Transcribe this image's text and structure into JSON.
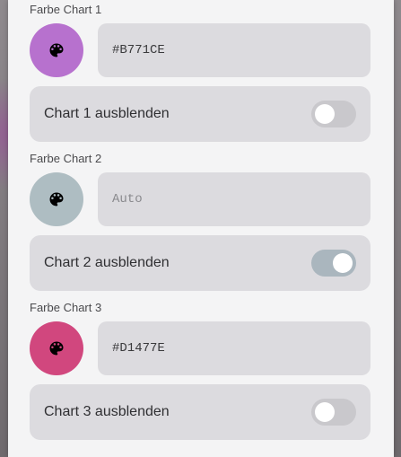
{
  "charts": [
    {
      "section_label": "Farbe Chart 1",
      "swatch_color": "#B771CE",
      "color_value": "#B771CE",
      "color_placeholder": "",
      "hide_label": "Chart 1 ausblenden",
      "hidden": false
    },
    {
      "section_label": "Farbe Chart 2",
      "swatch_color": "#AEBDC2",
      "color_value": "",
      "color_placeholder": "Auto",
      "hide_label": "Chart 2 ausblenden",
      "hidden": true
    },
    {
      "section_label": "Farbe Chart 3",
      "swatch_color": "#D1477E",
      "color_value": "#D1477E",
      "color_placeholder": "",
      "hide_label": "Chart 3 ausblenden",
      "hidden": false
    }
  ],
  "icons": {
    "swatch_icon": "palette-icon"
  },
  "colors": {
    "panel_background": "#F4F4F5",
    "field_background": "#DCDBDF",
    "switch_on_track": "#AAB6BE",
    "switch_off_track": "#C9C8CC"
  }
}
